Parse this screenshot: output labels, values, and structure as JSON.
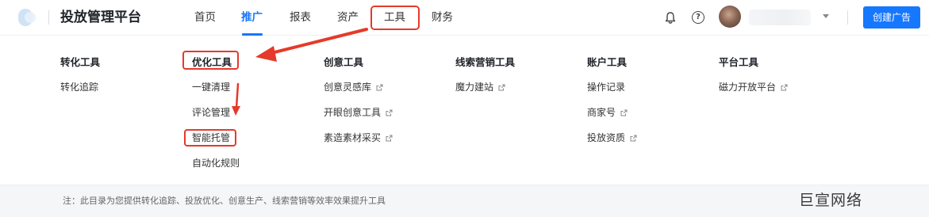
{
  "header": {
    "app_title": "投放管理平台",
    "logo_icon": "brand-logo-icon",
    "nav": [
      {
        "label": "首页",
        "active": false
      },
      {
        "label": "推广",
        "active": true
      },
      {
        "label": "报表",
        "active": false
      },
      {
        "label": "资产",
        "active": false
      },
      {
        "label": "工具",
        "active": false,
        "highlighted": true
      },
      {
        "label": "财务",
        "active": false
      }
    ],
    "icons": [
      "bell-icon",
      "help-icon",
      "chevron-down-icon"
    ],
    "create_button": "创建广告",
    "accent_color": "#1677ff"
  },
  "menu": {
    "columns": [
      {
        "title": "转化工具",
        "items": [
          {
            "label": "转化追踪",
            "external": false
          }
        ]
      },
      {
        "title": "优化工具",
        "highlighted": true,
        "items": [
          {
            "label": "一键清理",
            "external": false
          },
          {
            "label": "评论管理",
            "external": false
          },
          {
            "label": "智能托管",
            "external": false,
            "highlighted": true
          },
          {
            "label": "自动化规则",
            "external": false
          }
        ]
      },
      {
        "title": "创意工具",
        "items": [
          {
            "label": "创意灵感库",
            "external": true
          },
          {
            "label": "开眼创意工具",
            "external": true
          },
          {
            "label": "素造素材采买",
            "external": true
          }
        ]
      },
      {
        "title": "线索营销工具",
        "items": [
          {
            "label": "魔力建站",
            "external": true
          }
        ]
      },
      {
        "title": "账户工具",
        "items": [
          {
            "label": "操作记录",
            "external": false
          },
          {
            "label": "商家号",
            "external": true
          },
          {
            "label": "投放资质",
            "external": true
          }
        ]
      },
      {
        "title": "平台工具",
        "items": [
          {
            "label": "磁力开放平台",
            "external": true
          }
        ]
      }
    ]
  },
  "footer": {
    "note": "注：此目录为您提供转化追踪、投放优化、创意生产、线索营销等效率效果提升工具",
    "watermark": "巨宣网络"
  },
  "annotation_color": "#e53a2a"
}
